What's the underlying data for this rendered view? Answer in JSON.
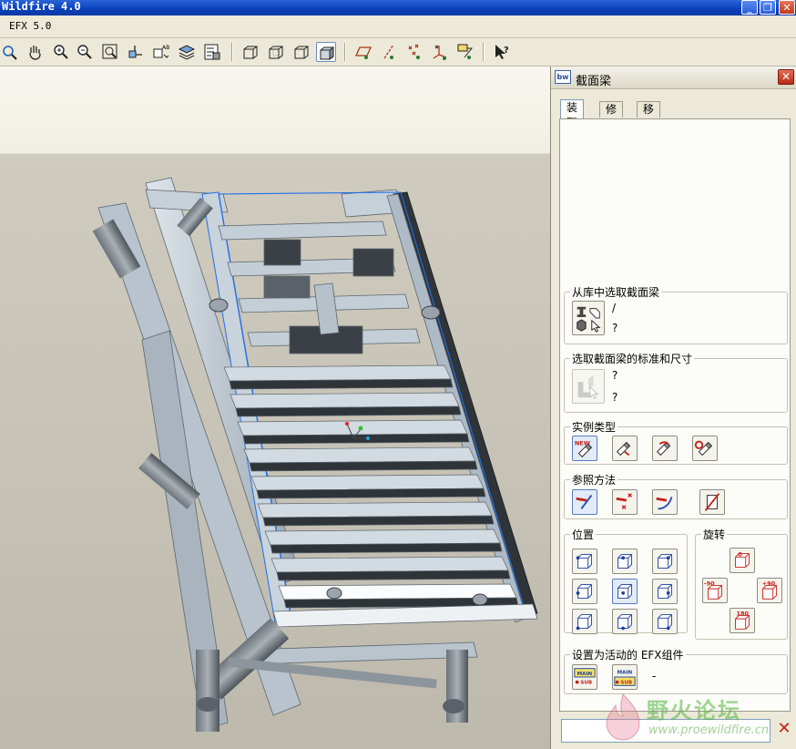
{
  "window": {
    "title": "Wildfire 4.0"
  },
  "menu": {
    "items": [
      "EFX 5.0"
    ]
  },
  "toolbar": {
    "tools": [
      "repaint-icon",
      "pan-icon",
      "zoom-in-icon",
      "zoom-out-icon",
      "fit-icon",
      "orient-icon",
      "saved-views-icon",
      "layers-icon",
      "model-tree-icon",
      "wireframe-icon",
      "hidden-line-icon",
      "no-hidden-icon",
      "shaded-icon",
      "datum-planes-icon",
      "datum-axes-icon",
      "datum-points-icon",
      "coord-sys-icon",
      "annotations-icon",
      "context-help-icon"
    ]
  },
  "panel": {
    "title": "截面梁",
    "logo": "bw",
    "tabs": [
      "装配",
      "修改",
      "移动"
    ],
    "active_tab": 0,
    "groups": {
      "library": {
        "label": "从库中选取截面梁",
        "line1": "/",
        "line2": "?"
      },
      "standard": {
        "label": "选取截面梁的标准和尺寸",
        "line1": "?",
        "line2": "?"
      },
      "instance": {
        "label": "实例类型"
      },
      "reference": {
        "label": "参照方法"
      },
      "position": {
        "label": "位置"
      },
      "rotation": {
        "label": "旋转",
        "minus90": "-90",
        "plus90": "+90",
        "r180": "180"
      },
      "component": {
        "label": "设置为活动的 EFX组件",
        "value": "-"
      }
    }
  },
  "watermark": {
    "text": "野火论坛",
    "url": "www.proewildfire.cn"
  },
  "colors": {
    "title_bar": "#0a3fb8",
    "beam_face": "#c9d3dc",
    "beam_dark": "#3b4046",
    "selection": "#1f6fe6"
  }
}
